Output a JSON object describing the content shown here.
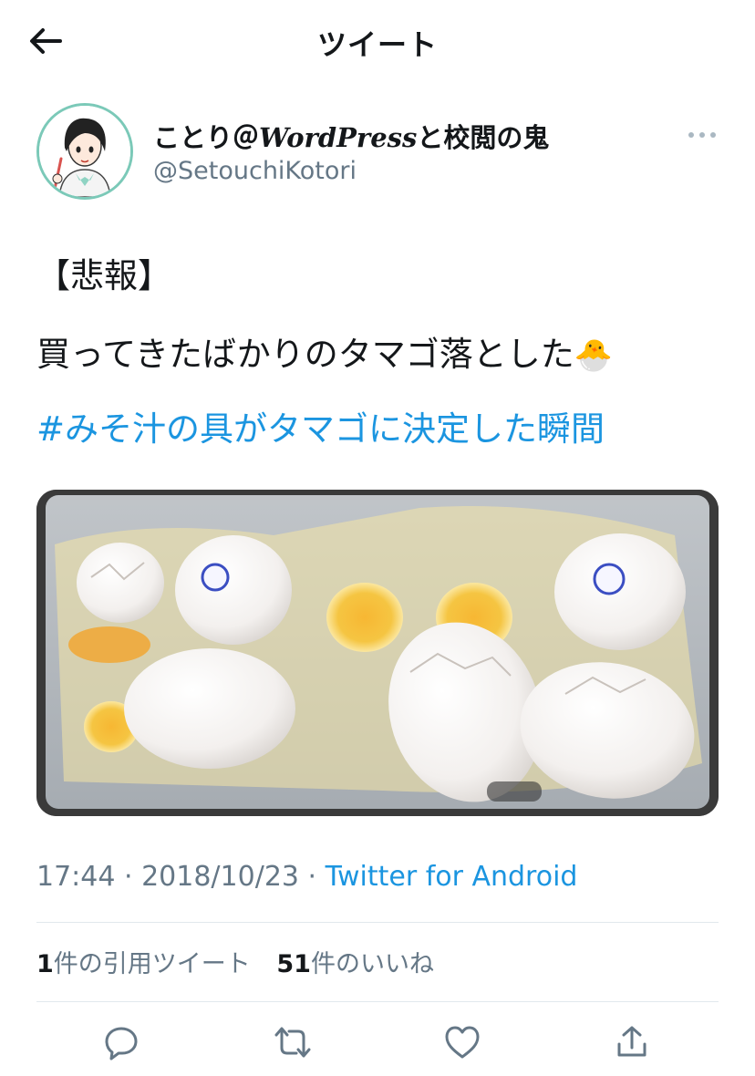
{
  "header": {
    "title": "ツイート",
    "back_icon": "arrow-left-icon"
  },
  "author": {
    "name_prefix": "ことり＠",
    "name_wp": "WordPress",
    "name_suffix": "と校閲の鬼",
    "handle": "@SetouchiKotori",
    "avatar_icon": "avatar-illustration"
  },
  "tweet": {
    "line1": "【悲報】",
    "line2": "買ってきたばかりのタマゴ落とした",
    "emoji": "🐣",
    "hashtag": "#みそ汁の具がタマゴに決定した瞬間"
  },
  "media": {
    "icon": "broken-eggs-photo"
  },
  "meta": {
    "time": "17:44",
    "sep1": " · ",
    "date": "2018/10/23",
    "sep2": " · ",
    "source": "Twitter for Android"
  },
  "stats": {
    "quotes_count": "1",
    "quotes_label": "件の引用ツイート",
    "likes_count": "51",
    "likes_label": "件のいいね"
  },
  "actions": {
    "reply_icon": "reply-icon",
    "retweet_icon": "retweet-icon",
    "like_icon": "heart-icon",
    "share_icon": "share-icon"
  },
  "colors": {
    "link": "#1b95e0",
    "secondary": "#657786",
    "divider": "#e1e8ed",
    "avatar_border": "#7bc9b8"
  }
}
